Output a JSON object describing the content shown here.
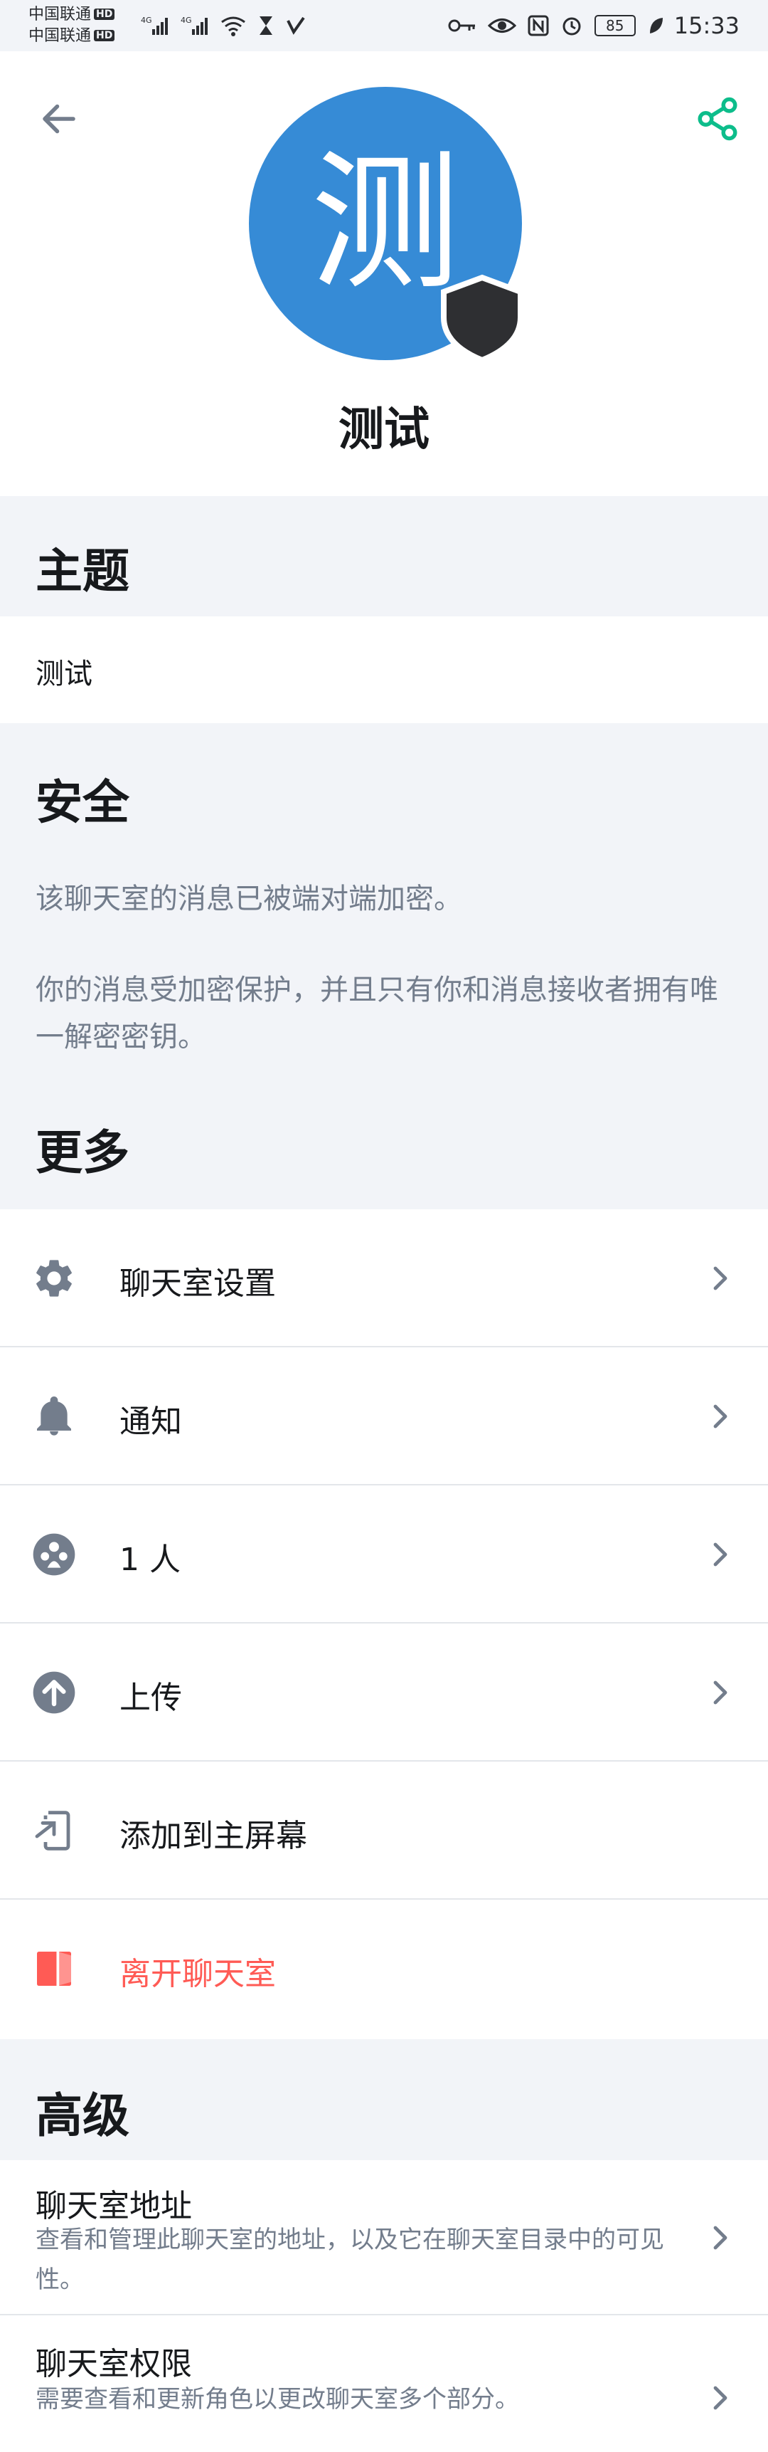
{
  "status_bar": {
    "carrier1": "中国联通",
    "carrier2": "中国联通",
    "hd": "HD",
    "battery": "85",
    "time": "15:33"
  },
  "header": {
    "avatar_letter": "测",
    "room_name": "测试",
    "avatar_color": "#368bd6"
  },
  "topic": {
    "title": "主题",
    "value": "测试"
  },
  "security": {
    "title": "安全",
    "line1": "该聊天室的消息已被端对端加密。",
    "line2": "你的消息受加密保护，并且只有你和消息接收者拥有唯一解密密钥。"
  },
  "more": {
    "title": "更多",
    "items": [
      {
        "label": "聊天室设置",
        "icon": "gear-icon"
      },
      {
        "label": "通知",
        "icon": "bell-icon"
      },
      {
        "label": "1 人",
        "icon": "people-icon"
      },
      {
        "label": "上传",
        "icon": "upload-icon"
      },
      {
        "label": "添加到主屏幕",
        "icon": "add-to-home-icon"
      },
      {
        "label": "离开聊天室",
        "icon": "leave-door-icon"
      }
    ]
  },
  "advanced": {
    "title": "高级",
    "items": [
      {
        "title": "聊天室地址",
        "desc": "查看和管理此聊天室的地址，以及它在聊天室目录中的可见性。"
      },
      {
        "title": "聊天室权限",
        "desc": "需要查看和更新角色以更改聊天室多个部分。"
      }
    ]
  },
  "colors": {
    "accent": "#0dbd8b",
    "danger": "#ff5b55",
    "section_bg": "#f2f4f8",
    "secondary_text": "#737d8c",
    "icon_gray": "#737d8c"
  }
}
